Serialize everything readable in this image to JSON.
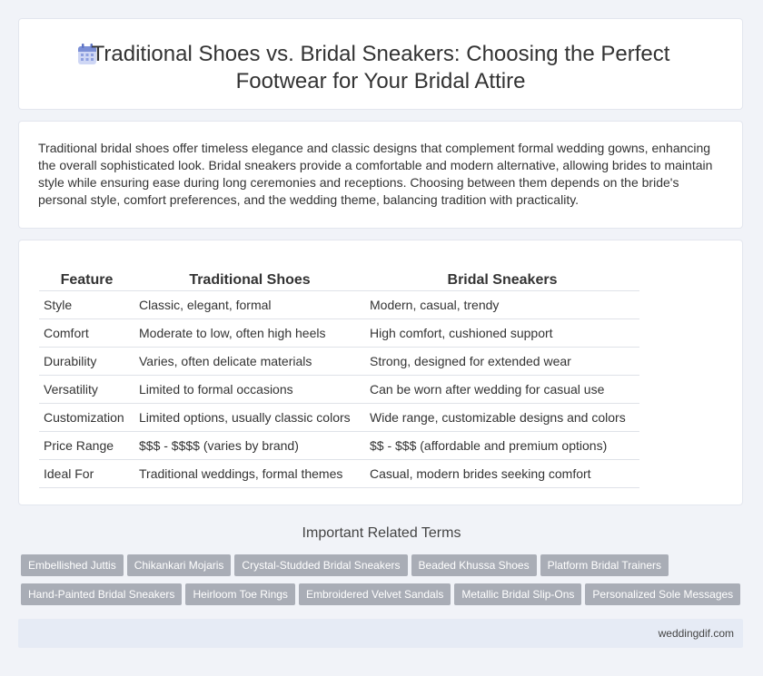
{
  "header": {
    "title_line1": "Traditional Shoes vs. Bridal Sneakers: Choosing the Perfect",
    "title_line2": "Footwear for Your Bridal Attire",
    "icon": "calendar-icon"
  },
  "summary": {
    "text": "Traditional bridal shoes offer timeless elegance and classic designs that complement formal wedding gowns, enhancing the overall sophisticated look. Bridal sneakers provide a comfortable and modern alternative, allowing brides to maintain style while ensuring ease during long ceremonies and receptions. Choosing between them depends on the bride's personal style, comfort preferences, and the wedding theme, balancing tradition with practicality."
  },
  "comparison": {
    "headers": [
      "Feature",
      "Traditional Shoes",
      "Bridal Sneakers"
    ],
    "rows": [
      [
        "Style",
        "Classic, elegant, formal",
        "Modern, casual, trendy"
      ],
      [
        "Comfort",
        "Moderate to low, often high heels",
        "High comfort, cushioned support"
      ],
      [
        "Durability",
        "Varies, often delicate materials",
        "Strong, designed for extended wear"
      ],
      [
        "Versatility",
        "Limited to formal occasions",
        "Can be worn after wedding for casual use"
      ],
      [
        "Customization",
        "Limited options, usually classic colors",
        "Wide range, customizable designs and colors"
      ],
      [
        "Price Range",
        "$$$ - $$$$ (varies by brand)",
        "$$ - $$$ (affordable and premium options)"
      ],
      [
        "Ideal For",
        "Traditional weddings, formal themes",
        "Casual, modern brides seeking comfort"
      ]
    ]
  },
  "related": {
    "heading": "Important Related Terms",
    "row1": [
      "Embellished Juttis",
      "Chikankari Mojaris",
      "Crystal-Studded Bridal Sneakers",
      "Beaded Khussa Shoes",
      "Platform Bridal Trainers"
    ],
    "row2": [
      "Hand-Painted Bridal Sneakers",
      "Heirloom Toe Rings",
      "Embroidered Velvet Sandals",
      "Metallic Bridal Slip-Ons",
      "Personalized Sole Messages"
    ]
  },
  "footer": {
    "site": "weddingdif.com"
  },
  "colors": {
    "background": "#f1f3f8",
    "tag": "#a9adb6",
    "footer": "#e6ebf5",
    "icon": "#7b8fd6"
  }
}
